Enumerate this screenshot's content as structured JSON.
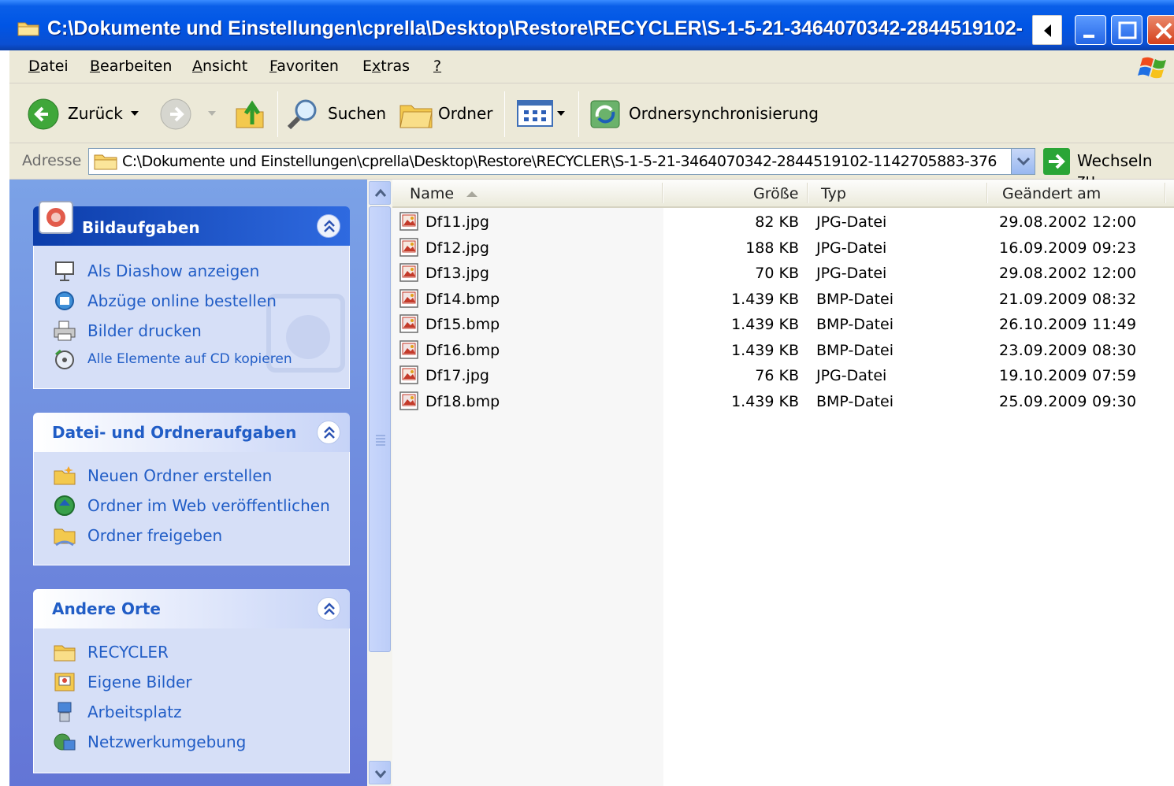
{
  "window": {
    "title": "C:\\Dokumente und Einstellungen\\cprella\\Desktop\\Restore\\RECYCLER\\S-1-5-21-3464070342-2844519102-"
  },
  "menu": {
    "items": [
      {
        "label": "Datei"
      },
      {
        "label": "Bearbeiten"
      },
      {
        "label": "Ansicht"
      },
      {
        "label": "Favoriten"
      },
      {
        "label": "Extras"
      },
      {
        "label": "?"
      }
    ]
  },
  "toolbar": {
    "back_label": "Zurück",
    "search_label": "Suchen",
    "folders_label": "Ordner",
    "sync_label": "Ordnersynchronisierung"
  },
  "address": {
    "label": "Adresse",
    "value": "C:\\Dokumente und Einstellungen\\cprella\\Desktop\\Restore\\RECYCLER\\S-1-5-21-3464070342-2844519102-1142705883-376",
    "go_label": "Wechseln zu"
  },
  "tasks": {
    "picture": {
      "title": "Bildaufgaben",
      "items": [
        {
          "label": "Als Diashow anzeigen"
        },
        {
          "label": "Abzüge online bestellen"
        },
        {
          "label": "Bilder drucken"
        },
        {
          "label": "Alle Elemente auf CD kopieren"
        }
      ]
    },
    "file": {
      "title": "Datei- und Ordneraufgaben",
      "items": [
        {
          "label": "Neuen Ordner erstellen"
        },
        {
          "label": "Ordner im Web veröffentlichen"
        },
        {
          "label": "Ordner freigeben"
        }
      ]
    },
    "places": {
      "title": "Andere Orte",
      "items": [
        {
          "label": "RECYCLER"
        },
        {
          "label": "Eigene Bilder"
        },
        {
          "label": "Arbeitsplatz"
        },
        {
          "label": "Netzwerkumgebung"
        }
      ]
    }
  },
  "columns": {
    "name": "Name",
    "size": "Größe",
    "type": "Typ",
    "modified": "Geändert am"
  },
  "files": [
    {
      "name": "Df11.jpg",
      "size": "82 KB",
      "type": "JPG-Datei",
      "modified": "29.08.2002 12:00"
    },
    {
      "name": "Df12.jpg",
      "size": "188 KB",
      "type": "JPG-Datei",
      "modified": "16.09.2009 09:23"
    },
    {
      "name": "Df13.jpg",
      "size": "70 KB",
      "type": "JPG-Datei",
      "modified": "29.08.2002 12:00"
    },
    {
      "name": "Df14.bmp",
      "size": "1.439 KB",
      "type": "BMP-Datei",
      "modified": "21.09.2009 08:32"
    },
    {
      "name": "Df15.bmp",
      "size": "1.439 KB",
      "type": "BMP-Datei",
      "modified": "26.10.2009 11:49"
    },
    {
      "name": "Df16.bmp",
      "size": "1.439 KB",
      "type": "BMP-Datei",
      "modified": "23.09.2009 08:30"
    },
    {
      "name": "Df17.jpg",
      "size": "76 KB",
      "type": "JPG-Datei",
      "modified": "19.10.2009 07:59"
    },
    {
      "name": "Df18.bmp",
      "size": "1.439 KB",
      "type": "BMP-Datei",
      "modified": "25.09.2009 09:30"
    }
  ]
}
